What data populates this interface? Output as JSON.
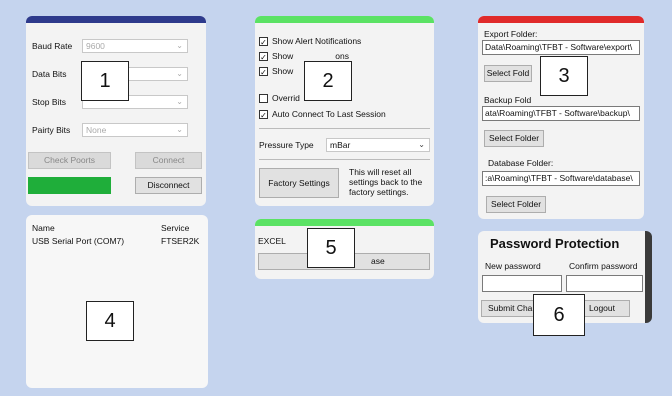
{
  "colors": {
    "background": "#c5d4ee",
    "panel": "#f3f3f3",
    "accent_blue": "#2e3a8c",
    "accent_green": "#5be264",
    "accent_red": "#e02a2a",
    "status_green": "#1fae3a"
  },
  "serial": {
    "baud_label": "Baud Rate",
    "baud_value": "9600",
    "data_bits_label": "Data Bits",
    "stop_bits_label": "Stop Bits",
    "parity_label": "Pairty Bits",
    "parity_value": "None",
    "check_ports": "Check Poorts",
    "connect": "Connect",
    "disconnect": "Disconnect"
  },
  "settings": {
    "show_alerts": "Show Alert Notifications",
    "show_2": "Show",
    "show_2_suffix": "ons",
    "show_3": "Show",
    "show_3_suffix": "ons",
    "override": "Overrid",
    "override_suffix": "s",
    "auto_connect": "Auto Connect To Last Session",
    "pressure_label": "Pressure Type",
    "pressure_value": "mBar",
    "factory_button": "Factory Settings",
    "factory_note": "This will reset all settings back to the factory settings."
  },
  "folders": {
    "export_label": "Export Folder:",
    "export_path": "Data\\Roaming\\TFBT - Software\\export\\",
    "backup_label": "Backup Fold",
    "backup_path": "ata\\Roaming\\TFBT - Software\\backup\\",
    "database_label": "Database Folder:",
    "database_path": ":a\\Roaming\\TFBT - Software\\database\\",
    "select_button": "Select Folder",
    "select_button_short": "Select Fold"
  },
  "ports": {
    "columns": [
      "Name",
      "Service"
    ],
    "rows": [
      [
        "USB Serial Port (COM7)",
        "FTSER2K"
      ]
    ]
  },
  "export": {
    "format": "EXCEL",
    "button_suffix": "ase"
  },
  "password": {
    "title": "Password Protection",
    "new_label": "New password",
    "confirm_label": "Confirm password",
    "submit": "Submit Cha",
    "logout": "Logout"
  },
  "callouts": [
    "1",
    "2",
    "3",
    "4",
    "5",
    "6"
  ]
}
